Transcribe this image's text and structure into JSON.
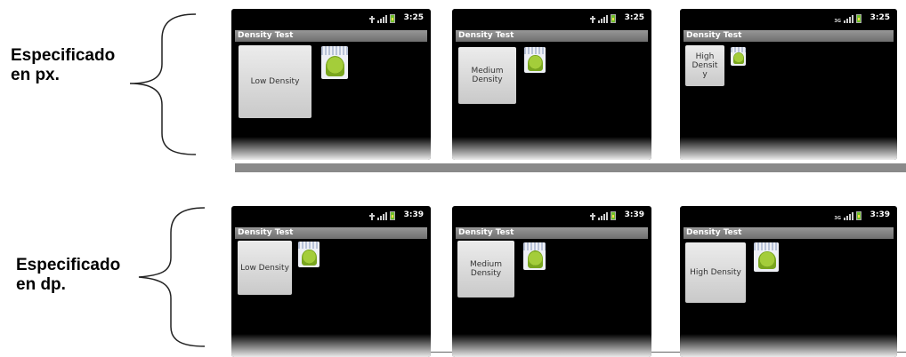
{
  "sections": [
    {
      "label_line1": "Especificado",
      "label_line2": "en px.",
      "screens": [
        {
          "time": "3:25",
          "title": "Density Test",
          "button": "Low Density"
        },
        {
          "time": "3:25",
          "title": "Density Test",
          "button": "Medium Density"
        },
        {
          "time": "3:25",
          "title": "Density Test",
          "button": "High Densit y"
        }
      ]
    },
    {
      "label_line1": "Especificado",
      "label_line2": "en dp.",
      "screens": [
        {
          "time": "3:39",
          "title": "Density Test",
          "button": "Low Density"
        },
        {
          "time": "3:39",
          "title": "Density Test",
          "button": "Medium Density"
        },
        {
          "time": "3:39",
          "title": "Density Test",
          "button": "High Density"
        }
      ]
    }
  ],
  "status_icons": [
    "usb-icon",
    "signal-icon",
    "battery-icon"
  ],
  "colors": {
    "screen_bg": "#000000",
    "titlebar": "#8a8a8a",
    "button_face": "#dedede",
    "divider": "#8a8a8a",
    "android_green": "#a4c639"
  }
}
